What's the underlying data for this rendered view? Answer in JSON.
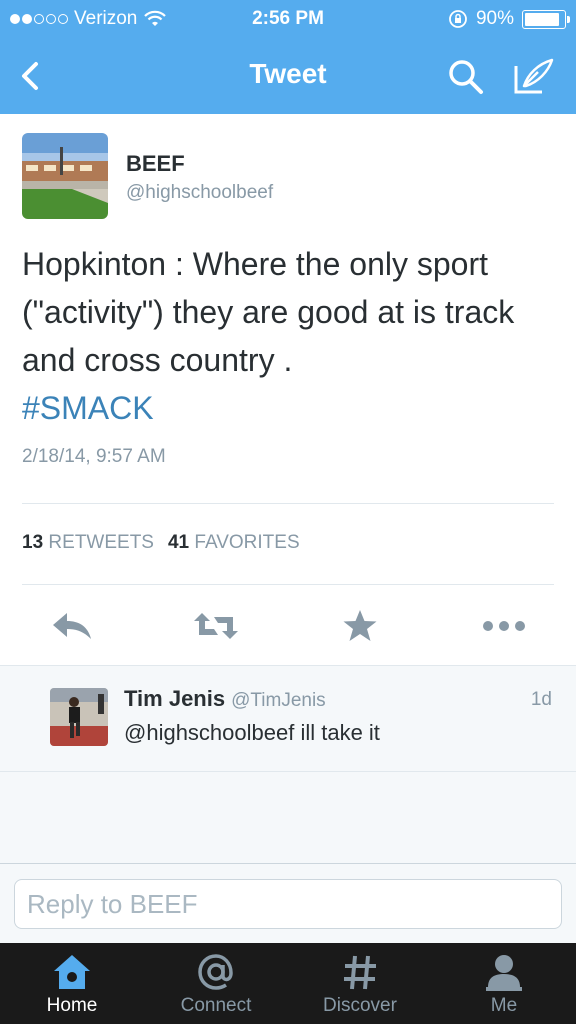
{
  "status_bar": {
    "carrier": "Verizon",
    "time": "2:56 PM",
    "battery": "90%",
    "battery_level": 0.9,
    "signal_bars": 2
  },
  "nav": {
    "title": "Tweet",
    "icons": [
      "back-chevron-icon",
      "search-icon",
      "compose-icon"
    ]
  },
  "tweet": {
    "author_name": "BEEF",
    "author_handle": "@highschoolbeef",
    "text": "Hopkinton : Where the only sport (\"activity\") they are good at is track and cross country .",
    "hashtag": "#SMACK",
    "timestamp": "2/18/14, 9:57 AM",
    "retweets_count": "13",
    "retweets_label": "RETWEETS",
    "favorites_count": "41",
    "favorites_label": "FAVORITES",
    "actions": [
      "reply-icon",
      "retweet-icon",
      "favorite-star-icon",
      "more-icon"
    ]
  },
  "replies": [
    {
      "name": "Tim Jenis",
      "handle": "@TimJenis",
      "time": "1d",
      "text": "@highschoolbeef ill take it"
    }
  ],
  "reply_bar": {
    "placeholder": "Reply to BEEF"
  },
  "tab_bar": {
    "tabs": [
      {
        "label": "Home",
        "icon": "home-icon",
        "active": true
      },
      {
        "label": "Connect",
        "icon": "at-icon",
        "active": false
      },
      {
        "label": "Discover",
        "icon": "hash-icon",
        "active": false
      },
      {
        "label": "Me",
        "icon": "person-icon",
        "active": false
      }
    ]
  },
  "colors": {
    "accent": "#55acee",
    "hashtag": "#3b83b8",
    "muted": "#8899a6",
    "tabbar": "#1a1a1a"
  }
}
